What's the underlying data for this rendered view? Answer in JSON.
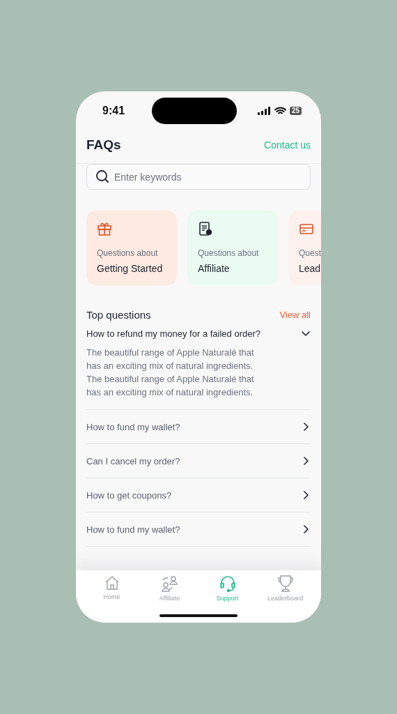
{
  "status_bar": {
    "time": "9:41",
    "battery": "25"
  },
  "header": {
    "title": "FAQs",
    "action": "Contact us"
  },
  "search": {
    "placeholder": "Enter keywords"
  },
  "categories": [
    {
      "caption": "Questions about",
      "title": "Getting Started",
      "color": "#fdeae0"
    },
    {
      "caption": "Questions about",
      "title": "Affiliate",
      "color": "#eafbf1"
    },
    {
      "caption": "Quest",
      "title": "Lead",
      "color": "#fdf1ee"
    }
  ],
  "top_questions": {
    "title": "Top questions",
    "action": "View all",
    "items": [
      {
        "question": "How to refund my money for a failed order?",
        "expanded": true,
        "answer": "The beautiful range of Apple Naturalé that has an exciting mix of natural ingredients. The beautiful range of Apple Naturalé that has an exciting mix of natural ingredients."
      },
      {
        "question": "How to fund my wallet?",
        "expanded": false
      },
      {
        "question": "Can I cancel my order?",
        "expanded": false
      },
      {
        "question": "How to get coupons?",
        "expanded": false
      },
      {
        "question": "How to fund my wallet?",
        "expanded": false
      }
    ]
  },
  "tab_bar": [
    {
      "label": "Home",
      "selected": false
    },
    {
      "label": "Affiliate",
      "selected": false
    },
    {
      "label": "Support",
      "selected": true
    },
    {
      "label": "Leaderboard",
      "selected": false
    }
  ]
}
